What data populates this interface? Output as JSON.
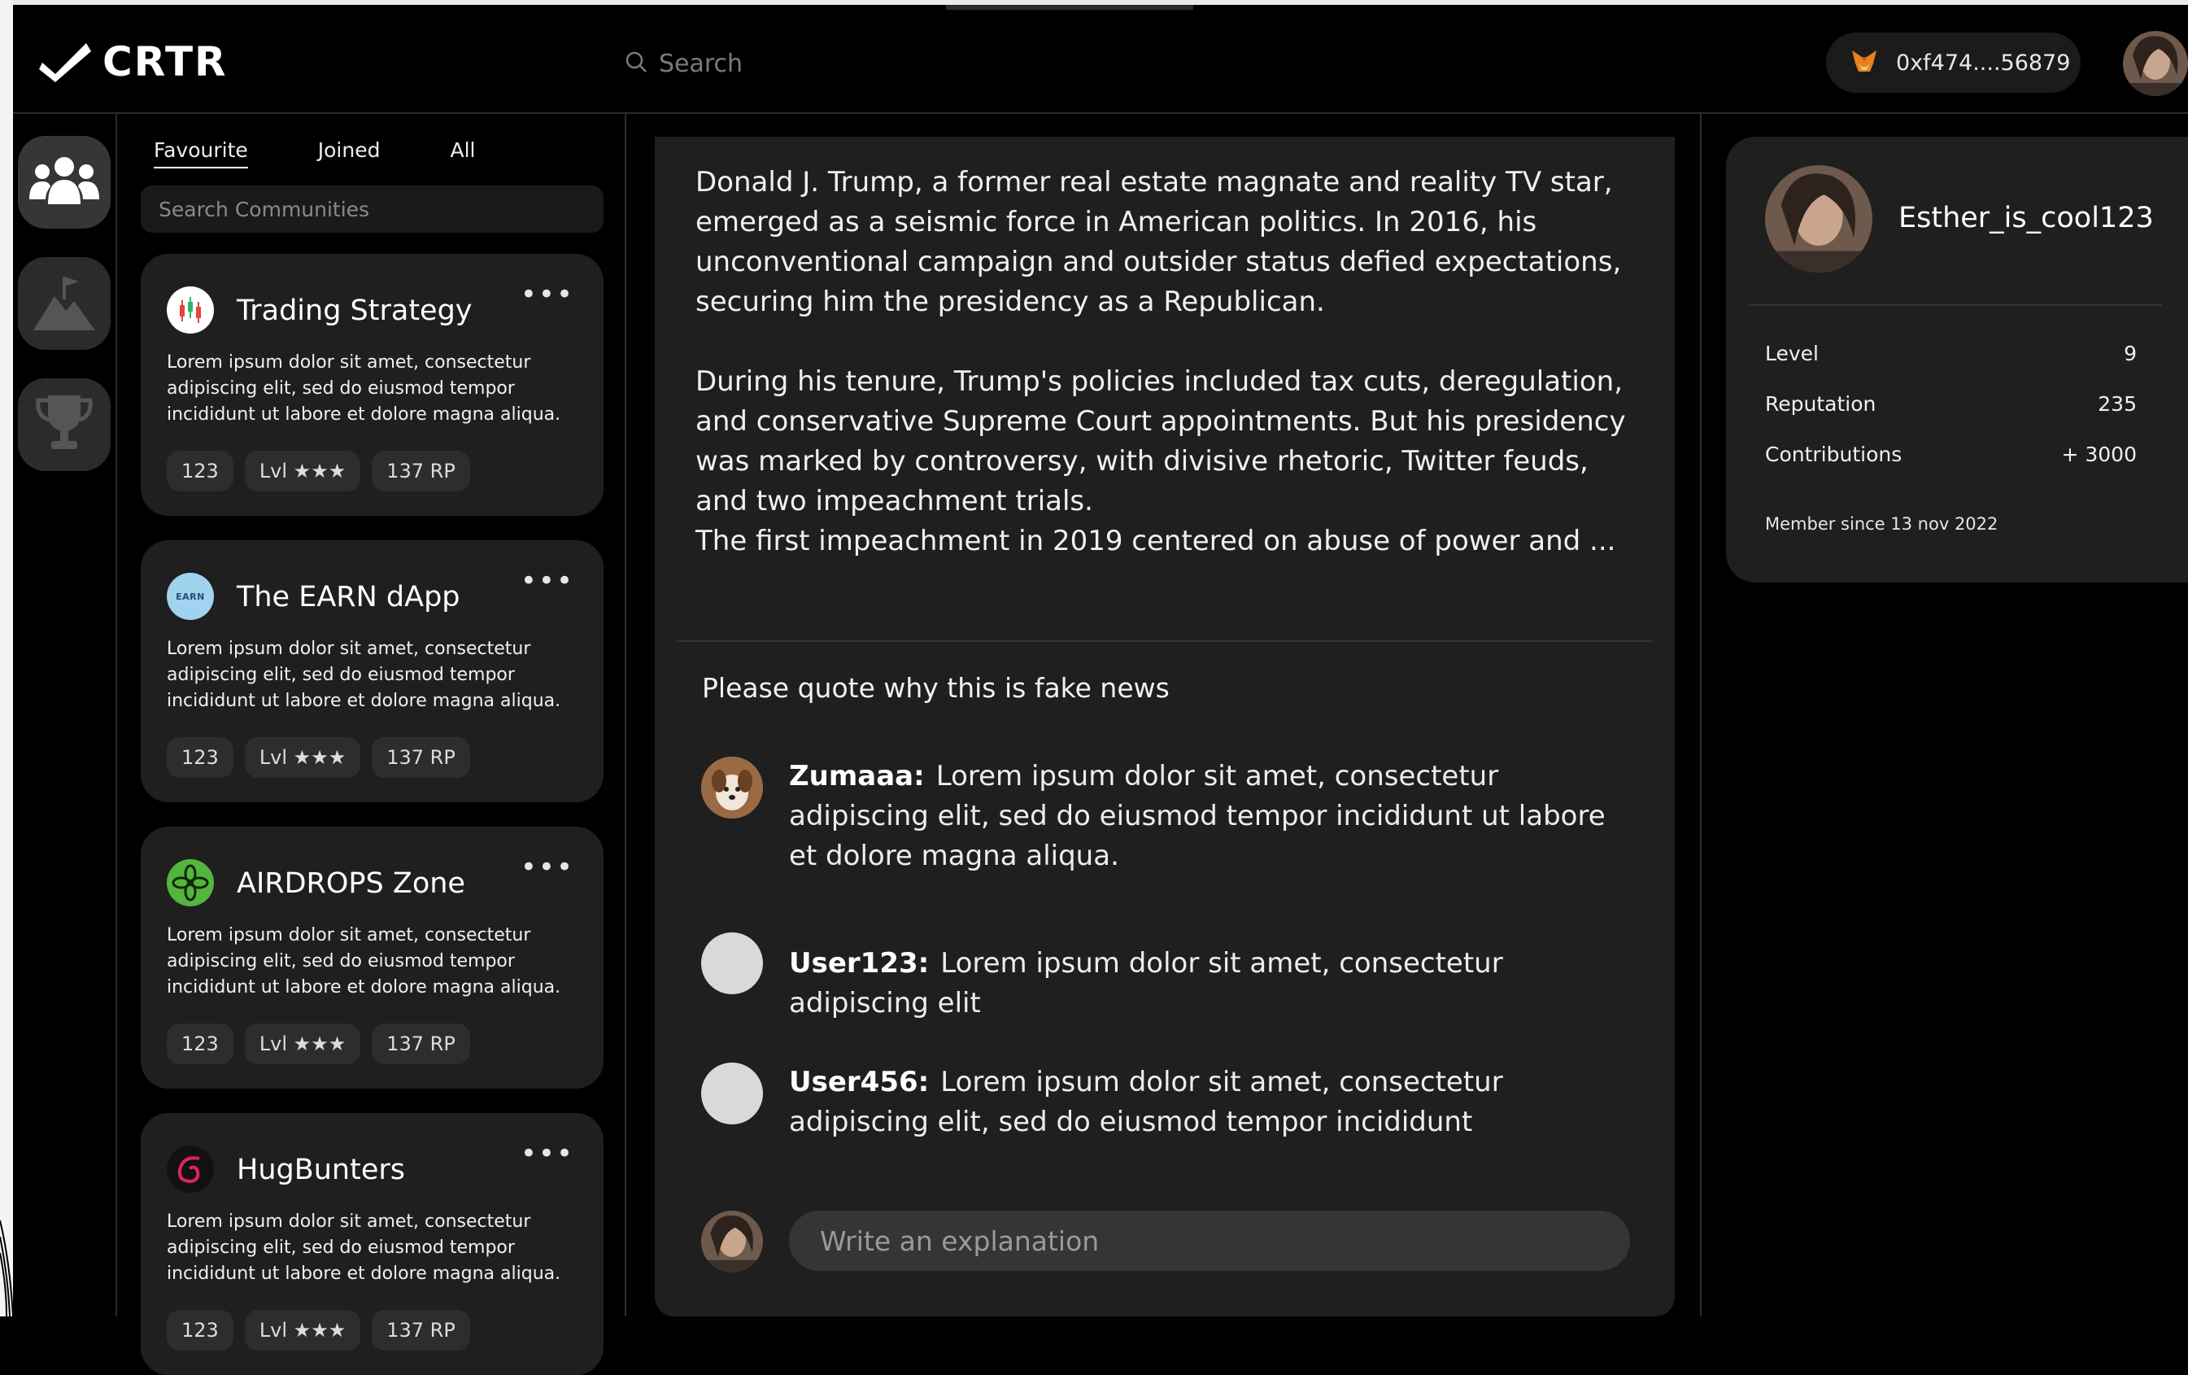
{
  "app": {
    "name": "CRTR"
  },
  "header": {
    "search_label": "Search",
    "wallet_address": "0xf474....56879"
  },
  "nav": {
    "tabs": [
      "Favourite",
      "Joined",
      "All"
    ],
    "active_tab": "Favourite",
    "community_search_placeholder": "Search Communities"
  },
  "communities": [
    {
      "name": "Trading Strategy",
      "description": "Lorem ipsum dolor sit amet, consectetur adipiscing elit, sed do eiusmod tempor incididunt ut labore et dolore magna aliqua.",
      "members": "123",
      "level": "Lvl ★★★",
      "rp": "137 RP",
      "logo_icon": "candlestick-icon"
    },
    {
      "name": "The EARN dApp",
      "description": "Lorem ipsum dolor sit amet, consectetur adipiscing elit, sed do eiusmod tempor incididunt ut labore et dolore magna aliqua.",
      "members": "123",
      "level": "Lvl ★★★",
      "rp": "137 RP",
      "logo_icon": "earn-logo",
      "logo_text": "EARN"
    },
    {
      "name": "AIRDROPS Zone",
      "description": "Lorem ipsum dolor sit amet, consectetur adipiscing elit, sed do eiusmod tempor incididunt ut labore et dolore magna aliqua.",
      "members": "123",
      "level": "Lvl ★★★",
      "rp": "137 RP",
      "logo_icon": "flower-icon"
    },
    {
      "name": "HugBunters",
      "description": "Lorem ipsum dolor sit amet, consectetur adipiscing elit, sed do eiusmod tempor incididunt ut labore et dolore magna aliqua.",
      "members": "123",
      "level": "Lvl ★★★",
      "rp": "137 RP",
      "logo_icon": "swirl-icon"
    }
  ],
  "post": {
    "paragraphs": [
      "Donald J. Trump, a former real estate magnate and reality TV star, emerged as a seismic force in American politics. In 2016, his unconventional campaign and outsider status defied expectations, securing him the presidency as a Republican.",
      "During his tenure, Trump's policies included tax cuts, deregulation, and conservative Supreme Court appointments. But his presidency was marked by controversy, with divisive rhetoric, Twitter feuds, and two impeachment trials.",
      "The first impeachment in 2019 centered on abuse of power and ..."
    ],
    "question": "Please quote why this is fake news",
    "comments": [
      {
        "user": "Zumaaa:",
        "text": "Lorem ipsum dolor sit amet, consectetur adipiscing elit, sed do eiusmod tempor incididunt ut labore et dolore magna aliqua."
      },
      {
        "user": "User123:",
        "text": "Lorem ipsum dolor sit amet, consectetur adipiscing elit"
      },
      {
        "user": "User456:",
        "text": "Lorem ipsum dolor sit amet, consectetur adipiscing elit, sed do eiusmod tempor incididunt"
      }
    ],
    "compose_placeholder": "Write an explanation"
  },
  "profile": {
    "username": "Esther_is_cool123",
    "stats": [
      {
        "label": "Level",
        "value": "9"
      },
      {
        "label": "Reputation",
        "value": "235"
      },
      {
        "label": "Contributions",
        "value": "+ 3000"
      }
    ],
    "member_since": "Member since 13 nov 2022"
  },
  "colors": {
    "background": "#000000",
    "panel": "#1f1f1f",
    "chip": "#2d2d2d",
    "input": "#353535"
  }
}
